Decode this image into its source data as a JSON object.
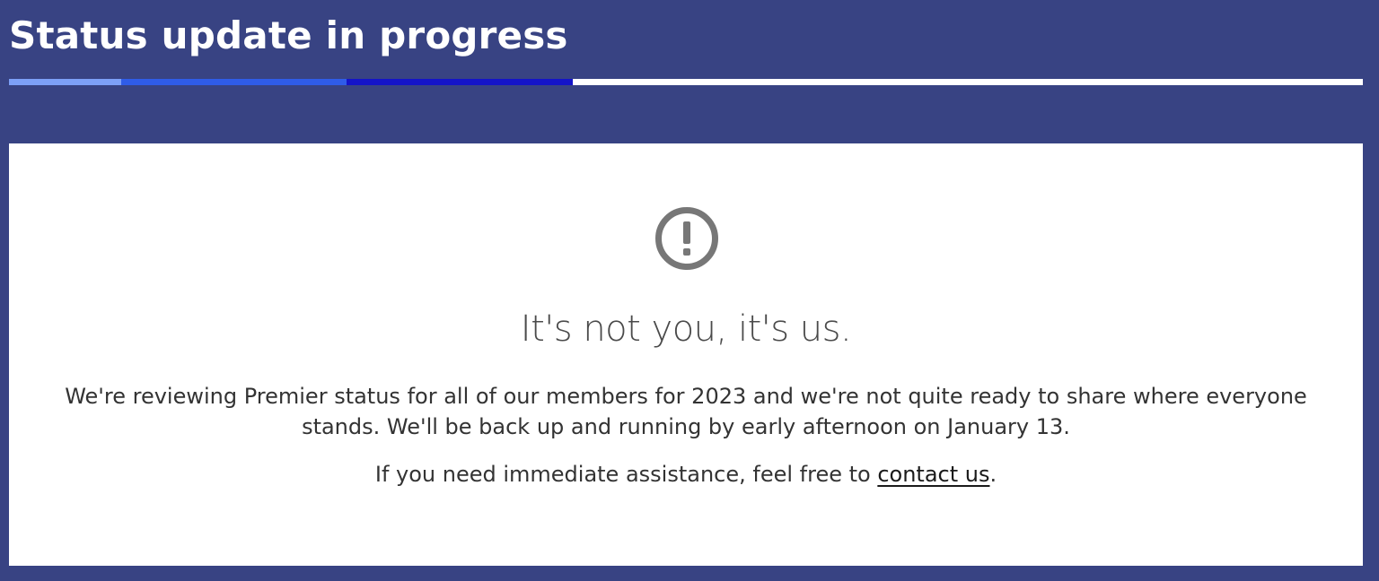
{
  "header": {
    "title": "Status update in progress"
  },
  "progress": {
    "segment_colors": [
      "#7da0f7",
      "#2f5ce8",
      "#1414c8",
      "#ffffff"
    ]
  },
  "notice": {
    "icon": "exclamation-circle-icon",
    "icon_color": "#777777",
    "heading": "It's not you, it's us.",
    "body": "We're reviewing Premier status for all of our members for 2023 and we're not quite ready to share where everyone stands. We'll be back up and running by early afternoon on January 13.",
    "help_prefix": "If you need immediate assistance, feel free to ",
    "help_link": "contact us",
    "help_suffix": "."
  },
  "colors": {
    "background": "#384383",
    "card": "#ffffff",
    "text": "#333333"
  }
}
